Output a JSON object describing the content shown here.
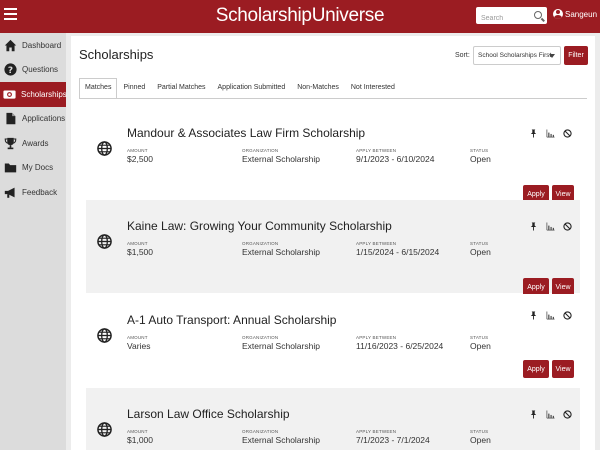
{
  "header": {
    "app_title": "ScholarshipUniverse",
    "search_placeholder": "Search",
    "user_name": "Sangeun"
  },
  "sidebar": {
    "items": [
      {
        "label": "Dashboard",
        "icon": "home-icon"
      },
      {
        "label": "Questions",
        "icon": "question-icon"
      },
      {
        "label": "Scholarships",
        "icon": "money-icon",
        "active": true
      },
      {
        "label": "Applications",
        "icon": "document-icon"
      },
      {
        "label": "Awards",
        "icon": "trophy-icon"
      },
      {
        "label": "My Docs",
        "icon": "folder-icon"
      },
      {
        "label": "Feedback",
        "icon": "megaphone-icon"
      }
    ]
  },
  "main": {
    "title": "Scholarships",
    "sort_label": "Sort:",
    "sort_value": "School Scholarships First",
    "filter_label": "Filter",
    "tabs": [
      "Matches",
      "Pinned",
      "Partial Matches",
      "Application Submitted",
      "Non-Matches",
      "Not Interested"
    ],
    "active_tab": "Matches"
  },
  "field_labels": {
    "amount": "AMOUNT",
    "organization": "ORGANIZATION",
    "apply_between": "APPLY BETWEEN",
    "status": "STATUS"
  },
  "actions": {
    "apply": "Apply",
    "view": "View"
  },
  "scholarships": [
    {
      "title": "Mandour & Associates Law Firm Scholarship",
      "amount": "$2,500",
      "organization": "External Scholarship",
      "apply_between": "9/1/2023 - 6/10/2024",
      "status": "Open"
    },
    {
      "title": "Kaine Law: Growing Your Community Scholarship",
      "amount": "$1,500",
      "organization": "External Scholarship",
      "apply_between": "1/15/2024 - 6/15/2024",
      "status": "Open"
    },
    {
      "title": "A-1 Auto Transport: Annual Scholarship",
      "amount": "Varies",
      "organization": "External Scholarship",
      "apply_between": "11/16/2023 - 6/25/2024",
      "status": "Open"
    },
    {
      "title": "Larson Law Office Scholarship",
      "amount": "$1,000",
      "organization": "External Scholarship",
      "apply_between": "7/1/2023 - 7/1/2024",
      "status": "Open"
    }
  ],
  "colors": {
    "brand": "#9b1c22",
    "sidebar_bg": "#dcdcdc",
    "card_alt_bg": "#f1f1f1"
  }
}
